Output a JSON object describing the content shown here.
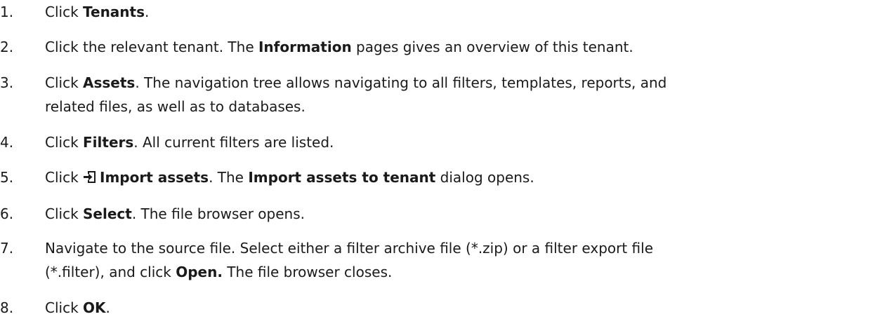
{
  "steps": [
    {
      "num": "1.",
      "parts": [
        {
          "t": "Click ",
          "b": false
        },
        {
          "t": "Tenants",
          "b": true
        },
        {
          "t": ".",
          "b": false
        }
      ]
    },
    {
      "num": "2.",
      "parts": [
        {
          "t": "Click the relevant tenant. The ",
          "b": false
        },
        {
          "t": "Information",
          "b": true
        },
        {
          "t": " pages gives an overview of this tenant.",
          "b": false
        }
      ]
    },
    {
      "num": "3.",
      "parts": [
        {
          "t": "Click ",
          "b": false
        },
        {
          "t": "Assets",
          "b": true
        },
        {
          "t": ". The navigation tree allows navigating to all filters, templates, reports, and",
          "b": false
        },
        {
          "br": true
        },
        {
          "t": "related files, as well as to databases.",
          "b": false
        }
      ]
    },
    {
      "num": "4.",
      "parts": [
        {
          "t": "Click ",
          "b": false
        },
        {
          "t": "Filters",
          "b": true
        },
        {
          "t": ". All current filters are listed.",
          "b": false
        }
      ]
    },
    {
      "num": "5.",
      "parts": [
        {
          "t": "Click ",
          "b": false
        },
        {
          "icon": "import-icon"
        },
        {
          "t": "Import assets",
          "b": true
        },
        {
          "t": ". The ",
          "b": false
        },
        {
          "t": "Import assets to tenant",
          "b": true
        },
        {
          "t": " dialog opens.",
          "b": false
        }
      ]
    },
    {
      "num": "6.",
      "parts": [
        {
          "t": "Click ",
          "b": false
        },
        {
          "t": "Select",
          "b": true
        },
        {
          "t": ". The file browser opens.",
          "b": false
        }
      ]
    },
    {
      "num": "7.",
      "parts": [
        {
          "t": "Navigate to the source file. Select either a filter archive file (*.zip) or a filter export file",
          "b": false
        },
        {
          "br": true
        },
        {
          "t": "(*.filter), and click ",
          "b": false
        },
        {
          "t": "Open.",
          "b": true
        },
        {
          "t": " The file browser closes.",
          "b": false
        }
      ]
    },
    {
      "num": "8.",
      "parts": [
        {
          "t": "Click ",
          "b": false
        },
        {
          "t": "OK",
          "b": true
        },
        {
          "t": ".",
          "b": false
        }
      ]
    }
  ]
}
